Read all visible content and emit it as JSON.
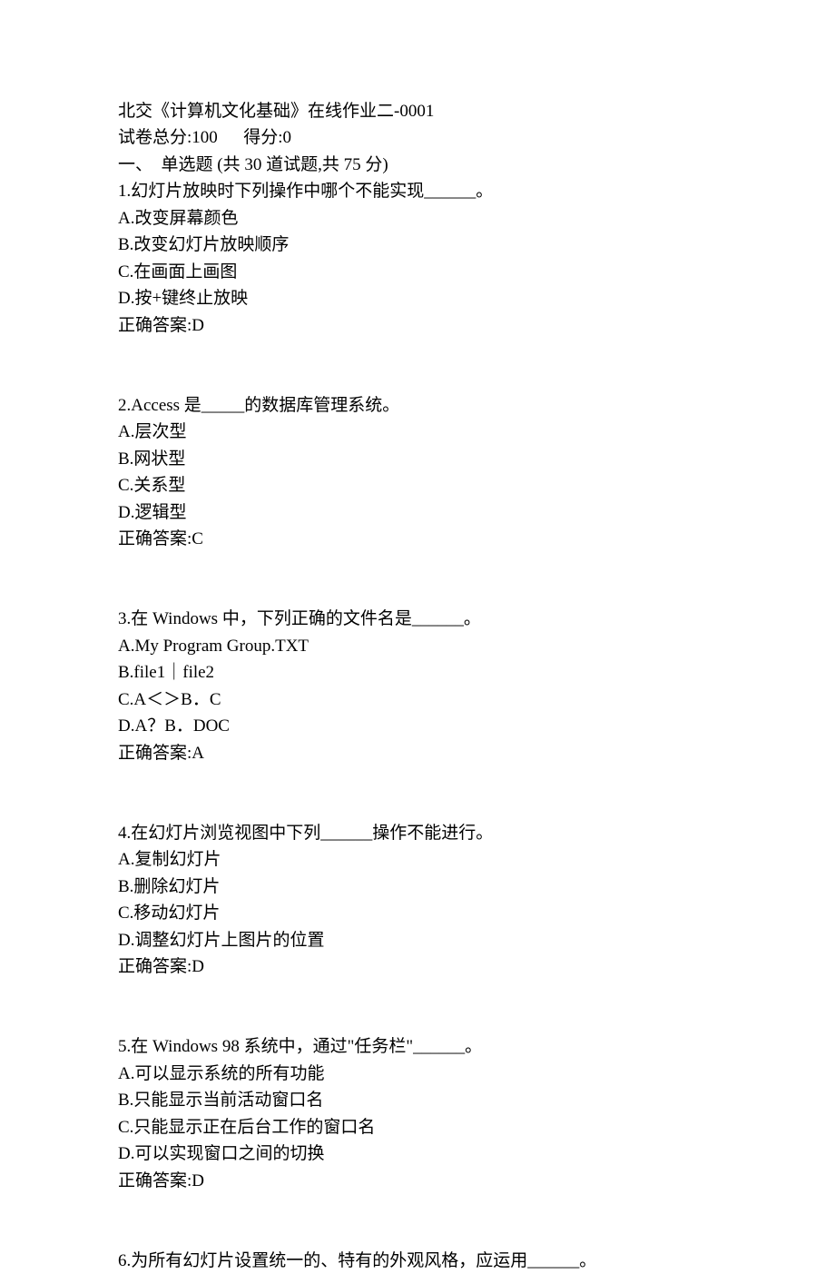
{
  "header": {
    "course_line": "北交《计算机文化基础》在线作业二-0001",
    "score_line": "试卷总分:100      得分:0",
    "section_line": "一、  单选题 (共 30 道试题,共 75 分)"
  },
  "questions": [
    {
      "stem": "1.幻灯片放映时下列操作中哪个不能实现______。",
      "options": [
        "A.改变屏幕颜色",
        "B.改变幻灯片放映顺序",
        "C.在画面上画图",
        "D.按+键终止放映"
      ],
      "answer": "正确答案:D"
    },
    {
      "stem": "2.Access 是_____的数据库管理系统。",
      "options": [
        "A.层次型",
        "B.网状型",
        "C.关系型",
        "D.逻辑型"
      ],
      "answer": "正确答案:C"
    },
    {
      "stem": "3.在 Windows 中，下列正确的文件名是______。",
      "options": [
        "A.My Program Group.TXT",
        "B.file1｜file2",
        "C.A＜＞B．C",
        "D.A？B．DOC"
      ],
      "answer": "正确答案:A"
    },
    {
      "stem": "4.在幻灯片浏览视图中下列______操作不能进行。",
      "options": [
        "A.复制幻灯片",
        "B.删除幻灯片",
        "C.移动幻灯片",
        "D.调整幻灯片上图片的位置"
      ],
      "answer": "正确答案:D"
    },
    {
      "stem": "5.在 Windows 98 系统中，通过\"任务栏\"______。",
      "options": [
        "A.可以显示系统的所有功能",
        "B.只能显示当前活动窗口名",
        "C.只能显示正在后台工作的窗口名",
        "D.可以实现窗口之间的切换"
      ],
      "answer": "正确答案:D"
    },
    {
      "stem": "6.为所有幻灯片设置统一的、特有的外观风格，应运用______。",
      "options": [],
      "answer": ""
    }
  ]
}
